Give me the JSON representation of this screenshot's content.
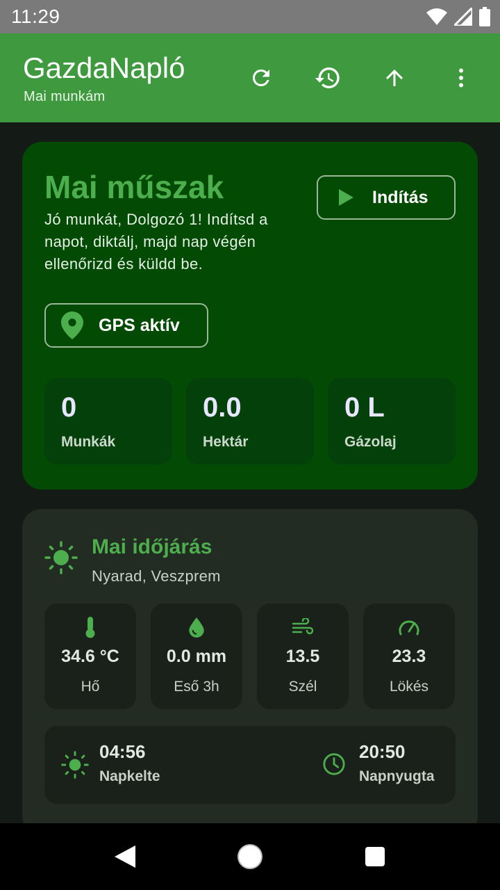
{
  "status_bar": {
    "time": "11:29",
    "icons": [
      "wifi-icon",
      "signal-icon",
      "battery-icon"
    ]
  },
  "app_bar": {
    "title": "GazdaNapló",
    "subtitle": "Mai munkám",
    "actions": [
      "refresh-icon",
      "history-icon",
      "upload-icon",
      "more-vert-icon"
    ]
  },
  "shift_card": {
    "title": "Mai műszak",
    "description": "Jó munkát, Dolgozó 1! Indítsd a napot, diktálj, majd nap végén ellenőrizd és küldd be.",
    "start_button_label": "Indítás",
    "gps_label": "GPS aktív",
    "stats": [
      {
        "value": "0",
        "label": "Munkák"
      },
      {
        "value": "0.0",
        "label": "Hektár"
      },
      {
        "value": "0 L",
        "label": "Gázolaj"
      }
    ]
  },
  "weather_card": {
    "title": "Mai időjárás",
    "location": "Nyarad, Veszprem",
    "tiles": [
      {
        "icon": "thermometer-icon",
        "value": "34.6 °C",
        "label": "Hő"
      },
      {
        "icon": "water-drop-icon",
        "value": "0.0 mm",
        "label": "Eső 3h"
      },
      {
        "icon": "wind-icon",
        "value": "13.5",
        "label": "Szél"
      },
      {
        "icon": "speedometer-icon",
        "value": "23.3",
        "label": "Lökés"
      }
    ],
    "sunrise": {
      "time": "04:56",
      "label": "Napkelte"
    },
    "sunset": {
      "time": "20:50",
      "label": "Napnyugta"
    }
  },
  "colors": {
    "app_bar": "#3f9a3f",
    "accent_green": "#4cae4c",
    "shift_card": "#034a04",
    "weather_card": "#222c23",
    "background": "#141a15"
  },
  "nav_bar": [
    "back-icon",
    "home-icon",
    "recents-icon"
  ]
}
